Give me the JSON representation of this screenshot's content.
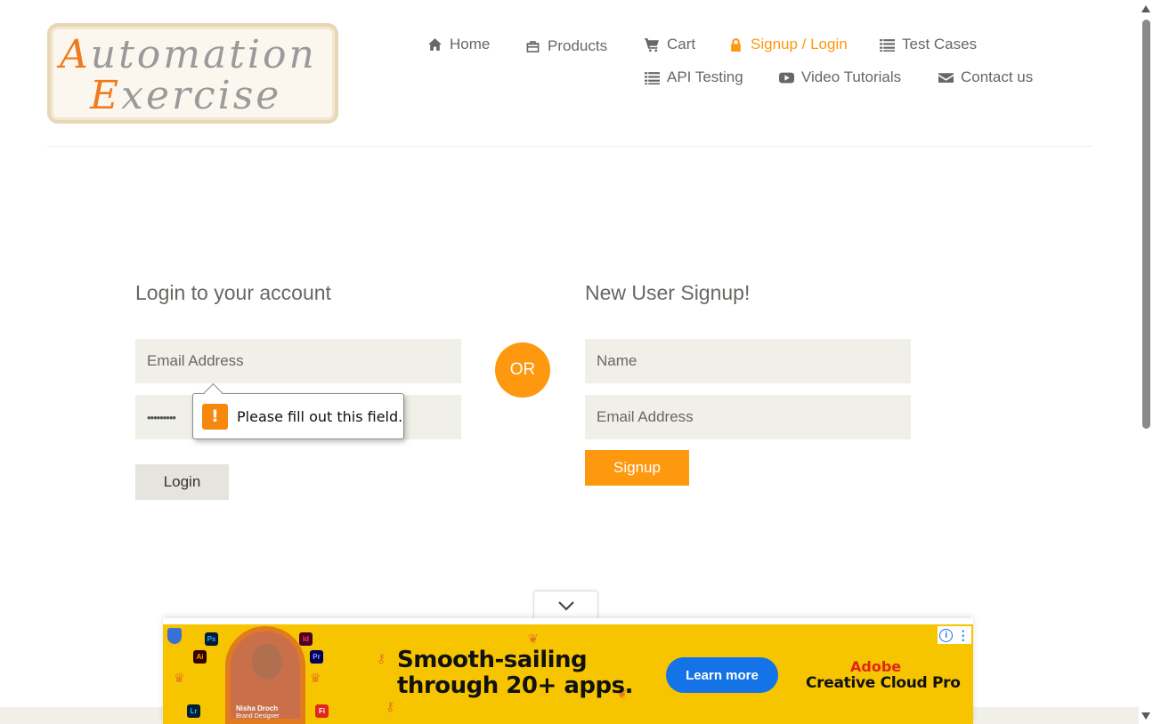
{
  "logo": {
    "line1_cap": "A",
    "line1_rest": "utomation",
    "line2_cap": "E",
    "line2_rest": "xercise"
  },
  "nav": {
    "home": "Home",
    "products": "Products",
    "cart": "Cart",
    "signup_login": "Signup / Login",
    "test_cases": "Test Cases",
    "api_testing": "API Testing",
    "video_tutorials": "Video Tutorials",
    "contact_us": "Contact us"
  },
  "login": {
    "title": "Login to your account",
    "email_placeholder": "Email Address",
    "password_value": "•••••••••",
    "button": "Login"
  },
  "or_label": "OR",
  "signup": {
    "title": "New User Signup!",
    "name_placeholder": "Name",
    "email_placeholder": "Email Address",
    "button": "Signup"
  },
  "validation_tooltip": {
    "icon": "!",
    "message": "Please fill out this field."
  },
  "ad": {
    "headline_line1": "Smooth-sailing",
    "headline_line2": "through 20+ apps.",
    "cta": "Learn more",
    "brand_line1": "Adobe",
    "brand_line2": "Creative Cloud Pro",
    "person_name": "Nisha Droch",
    "person_role": "Brand Designer",
    "apps": [
      "Ps",
      "Ai",
      "Id",
      "Pr",
      "Lr",
      "Fi"
    ],
    "info_icon": "i",
    "menu_icon": "⋮"
  },
  "colors": {
    "accent": "#fe980f",
    "text": "#696763",
    "field_bg": "#f0f0e9",
    "ad_bg": "#f6c500",
    "cta_blue": "#1473e6"
  }
}
